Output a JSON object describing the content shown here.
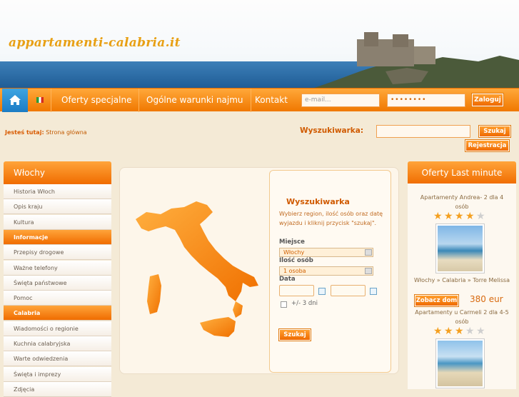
{
  "header": {
    "logo_text": "appartamenti-calabria.it"
  },
  "nav": {
    "items": [
      "Oferty specjalne",
      "Ogólne warunki najmu",
      "Kontakt"
    ],
    "email_placeholder": "e-mail...",
    "password_value": "••••••••",
    "login_label": "Zaloguj"
  },
  "breadcrumb": {
    "label": "Jesteś tutaj:",
    "current": "Strona główna"
  },
  "topsearch": {
    "label": "Wyszukiwarka:",
    "search_label": "Szukaj",
    "register_label": "Rejestracja"
  },
  "sidebar": {
    "title": "Włochy",
    "items": [
      {
        "label": "Historia Włoch",
        "cat": false
      },
      {
        "label": "Opis kraju",
        "cat": false
      },
      {
        "label": "Kultura",
        "cat": false
      },
      {
        "label": "Informacje",
        "cat": true
      },
      {
        "label": "Przepisy drogowe",
        "cat": false
      },
      {
        "label": "Ważne telefony",
        "cat": false
      },
      {
        "label": "Święta państwowe",
        "cat": false
      },
      {
        "label": "Pomoc",
        "cat": false
      },
      {
        "label": "Calabria",
        "cat": true
      },
      {
        "label": "Wiadomości o regionie",
        "cat": false
      },
      {
        "label": "Kuchnia calabryjska",
        "cat": false
      },
      {
        "label": "Warte odwiedzenia",
        "cat": false
      },
      {
        "label": "Święta i imprezy",
        "cat": false
      },
      {
        "label": "Zdjęcia",
        "cat": false
      }
    ]
  },
  "search": {
    "title": "Wyszukiwarka",
    "description": "Wybierz region, ilość osób oraz datę wyjazdu i kliknij przycisk \"szukaj\".",
    "place_label": "Miejsce",
    "place_value": "Włochy",
    "persons_label": "Ilość osób",
    "persons_value": "1 osoba",
    "date_label": "Data",
    "flex_label": "+/- 3 dni",
    "submit_label": "Szukaj"
  },
  "lastminute": {
    "title": "Oferty Last minute",
    "offers": [
      {
        "name": "Apartamenty Andrea- 2 dla 4 osób",
        "rating": 4,
        "location": "Włochy » Calabria » Torre Melissa",
        "button": "Zobacz dom",
        "price": "380 eur"
      },
      {
        "name": "Apartamenty u Carmeli 2 dla 4-5 osób",
        "rating": 3
      }
    ]
  },
  "colors": {
    "accent": "#f07800",
    "nav_active": "#1c7cc4"
  }
}
